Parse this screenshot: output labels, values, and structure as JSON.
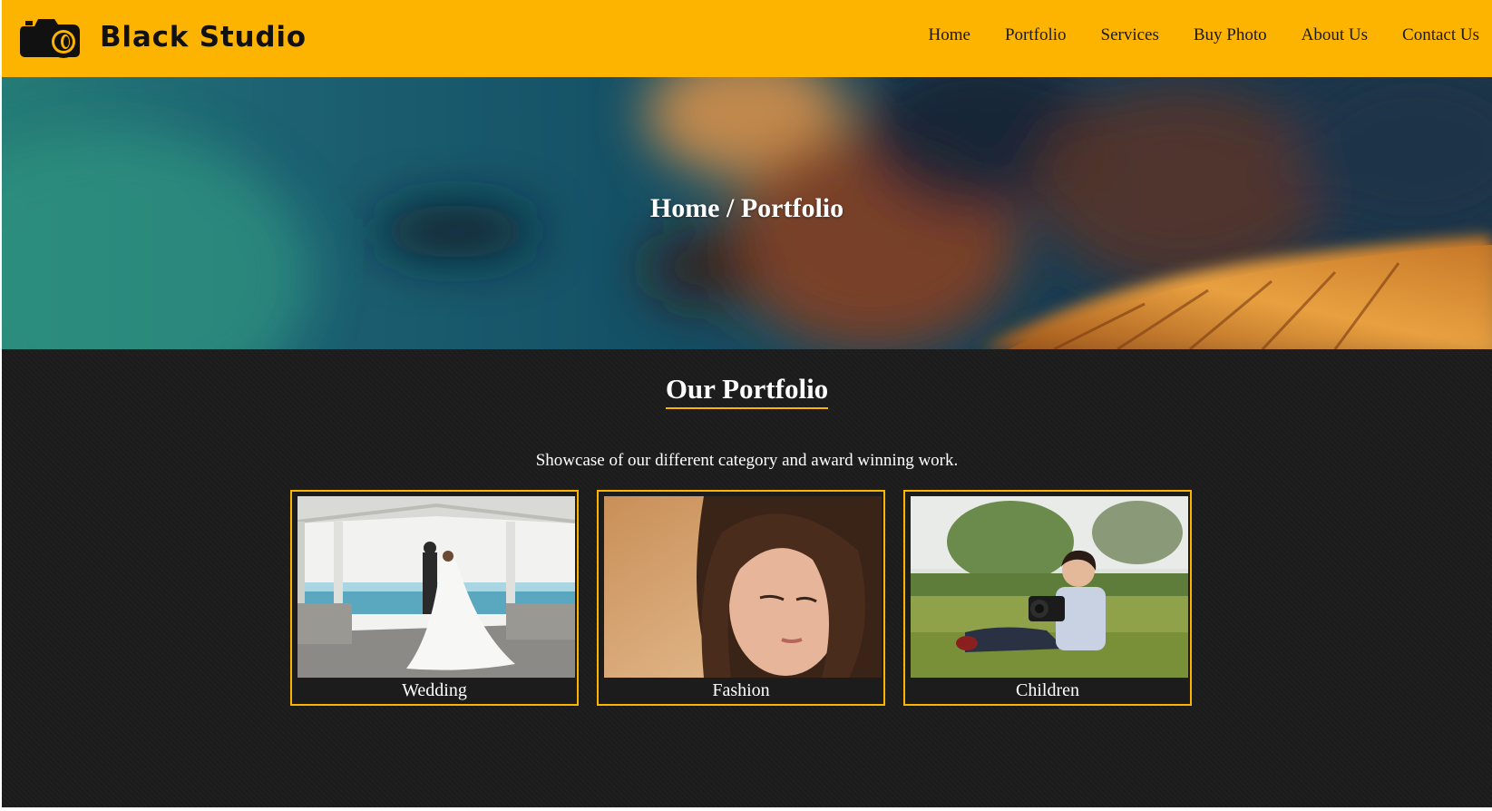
{
  "header": {
    "brand": "Black Studio",
    "logo_icon": "camera-icon",
    "background": "#FDB400",
    "nav": [
      {
        "label": "Home"
      },
      {
        "label": "Portfolio"
      },
      {
        "label": "Services"
      },
      {
        "label": "Buy Photo"
      },
      {
        "label": "About Us"
      },
      {
        "label": "Contact Us"
      }
    ]
  },
  "hero": {
    "breadcrumb": "Home / Portfolio"
  },
  "portfolio": {
    "title": "Our Portfolio",
    "description": "Showcase of our different category and award winning work.",
    "accent": "#FDB400",
    "cards": [
      {
        "label": "Wedding"
      },
      {
        "label": "Fashion"
      },
      {
        "label": "Children"
      }
    ]
  }
}
